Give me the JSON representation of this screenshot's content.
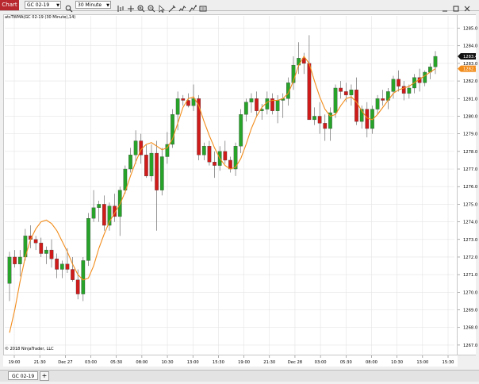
{
  "toolbar": {
    "chart_tab": "Chart",
    "instrument": "GC 02-19",
    "period": "30 Minute",
    "tools": [
      "bar-type-icon",
      "plus-icon",
      "zoom-in-icon",
      "zoom-out-icon",
      "cursor-icon",
      "draw-tool-icon",
      "indicator-icon",
      "strategy-icon",
      "properties-icon"
    ],
    "window_buttons": [
      "minimize-icon",
      "maximize-icon",
      "close-icon"
    ]
  },
  "indicator_label": "atsTWMA(GC 02-19 (30 Minute),14)",
  "copyright": "© 2018 NinjaTrader, LLC",
  "bottom_tabs": {
    "active": "GC 02-19",
    "add": "+"
  },
  "colors": {
    "up": "#27a32a",
    "down": "#d01b1b",
    "ma": "#f28c1b",
    "last_price_bg": "#111111",
    "ma_price_bg": "#f28c1b"
  },
  "price_badges": {
    "last": "1283.4",
    "ma": "1282.7"
  },
  "chart_data": {
    "type": "candlestick",
    "ylim": [
      1266.5,
      1285.7
    ],
    "yticks": [
      "1285.0",
      "1284.0",
      "1283.0",
      "1282.0",
      "1281.0",
      "1280.0",
      "1279.0",
      "1278.0",
      "1277.0",
      "1276.0",
      "1275.0",
      "1274.0",
      "1273.0",
      "1272.0",
      "1271.0",
      "1270.0",
      "1269.0",
      "1268.0",
      "1267.0"
    ],
    "xticks": [
      "19:00",
      "21:30",
      "Dec 27",
      "03:00",
      "05:30",
      "08:00",
      "10:30",
      "13:00",
      "15:30",
      "19:00",
      "21:30",
      "Dec 28",
      "03:00",
      "05:30",
      "08:00",
      "10:30",
      "13:00",
      "15:30"
    ],
    "candles": [
      [
        1270.5,
        1272.3,
        1269.5,
        1272.0
      ],
      [
        1272.0,
        1272.4,
        1271.4,
        1271.6
      ],
      [
        1271.6,
        1272.4,
        1270.9,
        1272.0
      ],
      [
        1272.0,
        1273.6,
        1271.8,
        1273.2
      ],
      [
        1273.2,
        1273.8,
        1272.5,
        1273.0
      ],
      [
        1273.0,
        1273.2,
        1272.4,
        1272.8
      ],
      [
        1272.8,
        1273.1,
        1272.0,
        1272.2
      ],
      [
        1272.2,
        1272.6,
        1271.6,
        1272.4
      ],
      [
        1272.4,
        1273.0,
        1271.4,
        1271.9
      ],
      [
        1271.9,
        1272.2,
        1270.8,
        1271.3
      ],
      [
        1271.3,
        1271.8,
        1270.8,
        1271.6
      ],
      [
        1271.6,
        1272.5,
        1271.1,
        1271.3
      ],
      [
        1271.3,
        1272.0,
        1270.6,
        1270.7
      ],
      [
        1270.7,
        1271.3,
        1269.6,
        1269.9
      ],
      [
        1269.9,
        1272.0,
        1269.5,
        1271.8
      ],
      [
        1271.8,
        1274.5,
        1271.5,
        1274.2
      ],
      [
        1274.2,
        1275.8,
        1274.0,
        1274.8
      ],
      [
        1274.8,
        1275.2,
        1274.0,
        1275.0
      ],
      [
        1275.0,
        1275.5,
        1273.5,
        1273.8
      ],
      [
        1273.8,
        1275.1,
        1273.5,
        1274.9
      ],
      [
        1274.9,
        1275.6,
        1274.0,
        1274.3
      ],
      [
        1274.3,
        1276.0,
        1273.2,
        1275.8
      ],
      [
        1275.8,
        1277.2,
        1275.6,
        1277.0
      ],
      [
        1277.0,
        1278.2,
        1276.8,
        1277.8
      ],
      [
        1277.8,
        1279.2,
        1277.3,
        1278.6
      ],
      [
        1278.6,
        1279.0,
        1277.3,
        1277.8
      ],
      [
        1277.8,
        1278.4,
        1276.5,
        1276.6
      ],
      [
        1276.6,
        1278.4,
        1276.3,
        1277.9
      ],
      [
        1277.9,
        1278.6,
        1273.5,
        1275.8
      ],
      [
        1275.8,
        1278.2,
        1275.5,
        1277.7
      ],
      [
        1277.7,
        1279.1,
        1277.3,
        1278.4
      ],
      [
        1278.4,
        1280.4,
        1278.2,
        1280.1
      ],
      [
        1280.1,
        1281.4,
        1279.2,
        1281.0
      ],
      [
        1281.0,
        1281.2,
        1280.6,
        1280.9
      ],
      [
        1280.9,
        1281.3,
        1280.5,
        1280.6
      ],
      [
        1280.6,
        1281.8,
        1280.3,
        1281.0
      ],
      [
        1281.0,
        1281.2,
        1277.5,
        1277.8
      ],
      [
        1277.8,
        1278.5,
        1277.5,
        1278.3
      ],
      [
        1278.3,
        1278.6,
        1277.2,
        1277.4
      ],
      [
        1277.4,
        1278.0,
        1276.5,
        1277.2
      ],
      [
        1277.2,
        1278.3,
        1276.9,
        1278.0
      ],
      [
        1278.0,
        1278.6,
        1277.3,
        1277.5
      ],
      [
        1277.5,
        1277.7,
        1276.8,
        1277.0
      ],
      [
        1277.0,
        1278.5,
        1276.6,
        1278.3
      ],
      [
        1278.3,
        1280.4,
        1277.9,
        1280.1
      ],
      [
        1280.1,
        1281.0,
        1279.7,
        1280.8
      ],
      [
        1280.8,
        1281.3,
        1280.2,
        1281.0
      ],
      [
        1281.0,
        1281.4,
        1280.0,
        1280.3
      ],
      [
        1280.3,
        1280.7,
        1279.8,
        1280.4
      ],
      [
        1280.4,
        1281.4,
        1280.1,
        1281.0
      ],
      [
        1281.0,
        1281.3,
        1280.1,
        1280.3
      ],
      [
        1280.3,
        1281.2,
        1279.6,
        1280.9
      ],
      [
        1280.9,
        1281.3,
        1279.9,
        1281.0
      ],
      [
        1281.0,
        1282.2,
        1280.6,
        1281.9
      ],
      [
        1281.9,
        1283.4,
        1281.5,
        1282.9
      ],
      [
        1282.9,
        1284.2,
        1282.4,
        1283.3
      ],
      [
        1283.3,
        1283.6,
        1282.4,
        1283.0
      ],
      [
        1283.0,
        1284.6,
        1279.8,
        1279.8
      ],
      [
        1279.8,
        1280.5,
        1279.5,
        1280.0
      ],
      [
        1280.0,
        1280.8,
        1279.0,
        1279.6
      ],
      [
        1279.6,
        1280.1,
        1278.6,
        1279.3
      ],
      [
        1279.3,
        1280.5,
        1278.6,
        1280.2
      ],
      [
        1280.2,
        1281.8,
        1279.9,
        1281.6
      ],
      [
        1281.6,
        1282.0,
        1281.0,
        1281.4
      ],
      [
        1281.4,
        1281.9,
        1280.8,
        1281.2
      ],
      [
        1281.2,
        1281.8,
        1280.6,
        1281.5
      ],
      [
        1281.5,
        1282.2,
        1279.5,
        1279.7
      ],
      [
        1279.7,
        1280.6,
        1279.3,
        1280.4
      ],
      [
        1280.4,
        1280.8,
        1278.8,
        1279.3
      ],
      [
        1279.3,
        1280.6,
        1279.0,
        1280.4
      ],
      [
        1280.4,
        1281.2,
        1280.1,
        1281.0
      ],
      [
        1281.0,
        1281.5,
        1280.6,
        1280.9
      ],
      [
        1280.9,
        1281.6,
        1280.4,
        1281.4
      ],
      [
        1281.4,
        1282.3,
        1281.0,
        1282.1
      ],
      [
        1282.1,
        1282.6,
        1281.4,
        1281.7
      ],
      [
        1281.7,
        1282.0,
        1280.9,
        1281.3
      ],
      [
        1281.3,
        1281.8,
        1281.0,
        1281.6
      ],
      [
        1281.6,
        1282.4,
        1281.3,
        1282.2
      ],
      [
        1282.2,
        1282.7,
        1281.4,
        1281.9
      ],
      [
        1281.9,
        1282.6,
        1281.7,
        1282.5
      ],
      [
        1282.5,
        1283.0,
        1282.1,
        1282.8
      ],
      [
        1282.8,
        1283.7,
        1282.4,
        1283.4
      ]
    ],
    "ma": [
      1267.7,
      1269.0,
      1270.6,
      1272.0,
      1273.0,
      1273.6,
      1274.0,
      1274.1,
      1273.9,
      1273.5,
      1272.9,
      1272.3,
      1271.6,
      1271.0,
      1270.7,
      1270.8,
      1271.5,
      1272.5,
      1273.3,
      1274.0,
      1274.5,
      1275.0,
      1275.7,
      1276.6,
      1277.4,
      1278.1,
      1278.4,
      1278.5,
      1278.3,
      1278.1,
      1278.2,
      1278.7,
      1279.6,
      1280.5,
      1281.0,
      1281.1,
      1280.6,
      1279.7,
      1278.9,
      1278.2,
      1277.6,
      1277.2,
      1277.0,
      1277.1,
      1277.6,
      1278.4,
      1279.3,
      1280.0,
      1280.5,
      1280.8,
      1280.9,
      1280.9,
      1281.0,
      1281.3,
      1282.0,
      1282.9,
      1283.4,
      1283.0,
      1282.0,
      1281.1,
      1280.4,
      1280.0,
      1280.1,
      1280.6,
      1281.0,
      1281.1,
      1280.8,
      1280.3,
      1279.9,
      1279.8,
      1280.1,
      1280.5,
      1280.9,
      1281.3,
      1281.5,
      1281.6,
      1281.7,
      1281.9,
      1282.1,
      1282.3,
      1282.5,
      1282.7
    ]
  }
}
